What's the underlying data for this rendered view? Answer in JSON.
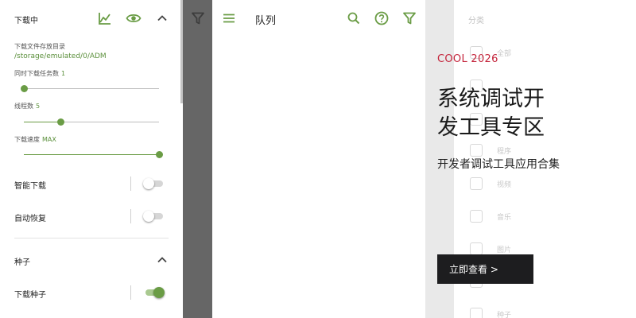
{
  "settings": {
    "downloading": {
      "title": "下载中"
    },
    "folder": {
      "label": "下载文件存放目录",
      "path": "/storage/emulated/0/ADM"
    },
    "tasks": {
      "label": "同时下载任务数",
      "value": "1",
      "level": 0.0
    },
    "threads": {
      "label": "线程数",
      "value": "5",
      "level": 0.27
    },
    "speed": {
      "label": "下载速度",
      "value": "MAX",
      "level": 1.0
    },
    "smart_download": {
      "label": "智能下载",
      "on": false
    },
    "auto_resume": {
      "label": "自动恢复",
      "on": false
    },
    "torrent": {
      "title": "种子"
    },
    "download_torrent": {
      "label": "下载种子",
      "on": true
    }
  },
  "queue": {
    "title": "队列"
  },
  "ghost_menu": {
    "title": "分类",
    "items": [
      {
        "label": "全部",
        "icon": "refresh-icon"
      },
      {
        "label": "",
        "icon": "image-icon"
      },
      {
        "label": "",
        "icon": "app-icon"
      },
      {
        "label": "程序",
        "icon": "phone-icon"
      },
      {
        "label": "视频",
        "icon": "video-icon"
      },
      {
        "label": "音乐",
        "icon": "headphones-icon"
      },
      {
        "label": "图片",
        "icon": "picture-icon"
      },
      {
        "label": "",
        "icon": "document-icon"
      },
      {
        "label": "种子",
        "icon": "torrent-icon"
      }
    ]
  },
  "ad": {
    "tag": "COOL 2026",
    "headline_line1": "系统调试开",
    "headline_line2": "发工具专区",
    "subtitle": "开发者调试工具应用合集",
    "cta": "立即查看 >"
  },
  "colors": {
    "accent": "#6a9c45",
    "ad_tag": "#c4243b",
    "strip": "#666666"
  }
}
